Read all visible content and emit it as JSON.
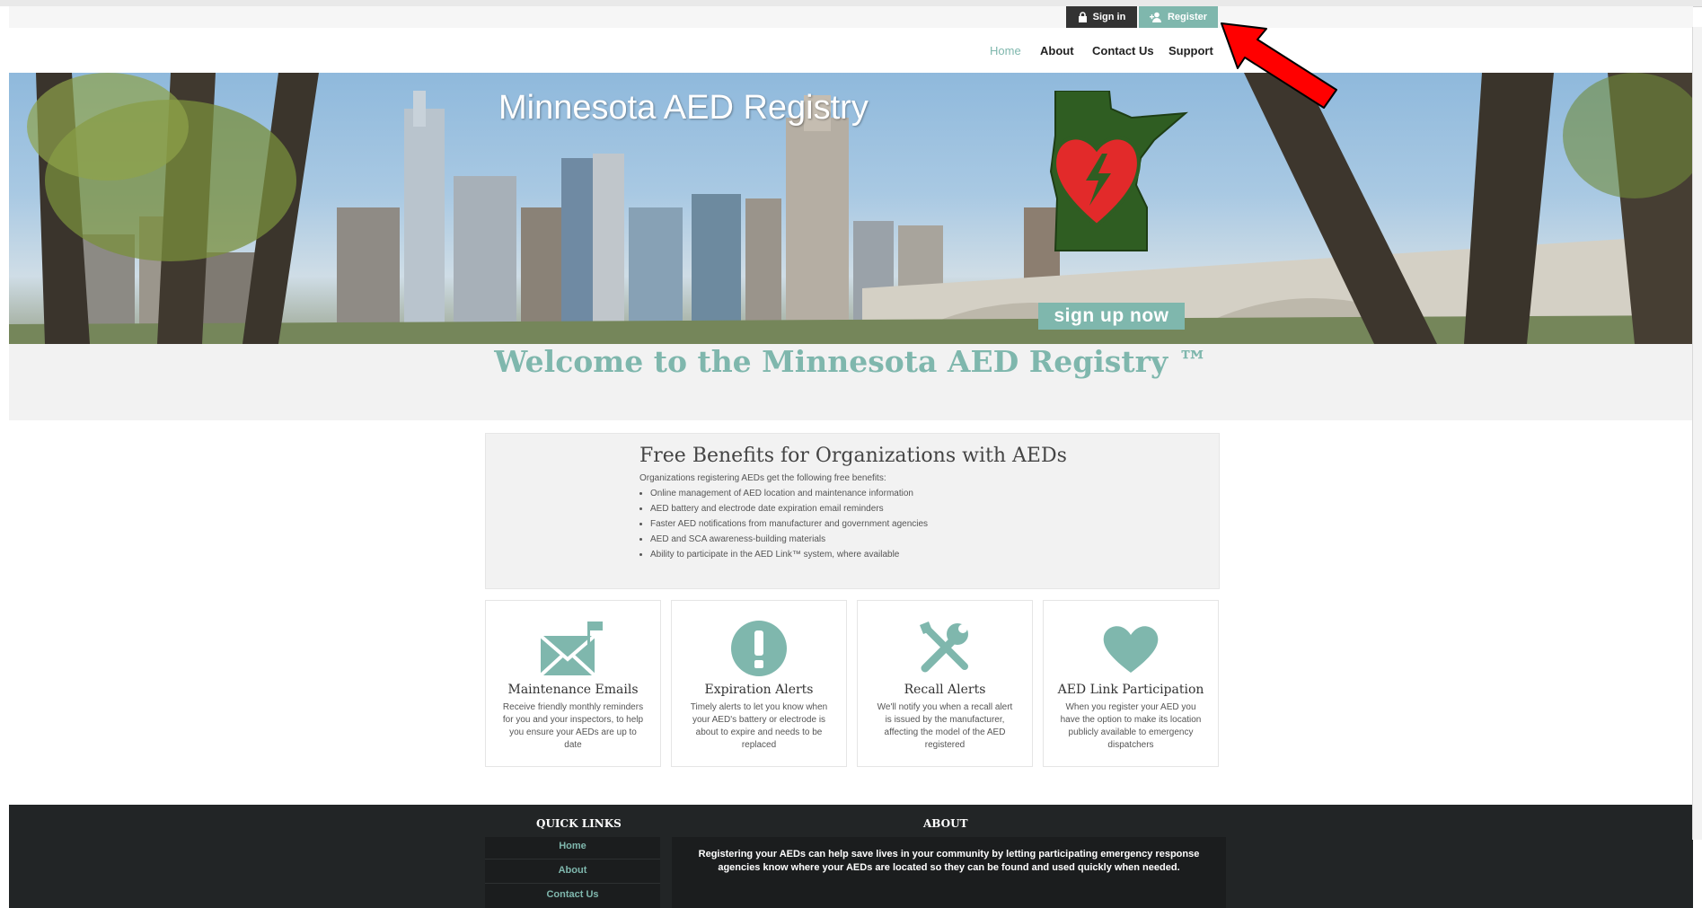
{
  "topbar": {
    "signin_label": "Sign in",
    "register_label": "Register"
  },
  "nav": {
    "home": "Home",
    "about": "About",
    "contact": "Contact Us",
    "support": "Support"
  },
  "hero": {
    "title": "Minnesota AED Registry",
    "signup_label": "sign up now"
  },
  "welcome": "Welcome to the Minnesota AED Registry ™",
  "benefits": {
    "title": "Free Benefits for Organizations with AEDs",
    "subtitle": "Organizations registering AEDs get the following free benefits:",
    "items": [
      "Online management of AED location and maintenance information",
      "AED battery and electrode date expiration email reminders",
      "Faster AED notifications from manufacturer and government agencies",
      "AED and SCA awareness-building materials",
      "Ability to participate in the AED Link™ system, where available"
    ]
  },
  "cards": [
    {
      "title": "Maintenance Emails",
      "desc": "Receive friendly monthly reminders for you and your inspectors, to help you ensure your AEDs are up to date",
      "icon": "envelope-icon"
    },
    {
      "title": "Expiration Alerts",
      "desc": "Timely alerts to let you know when your AED's battery or electrode is about to expire and needs to be replaced",
      "icon": "exclamation-icon"
    },
    {
      "title": "Recall Alerts",
      "desc": "We'll notify you when a recall alert is issued by the manufacturer, affecting the model of the AED registered",
      "icon": "tools-icon"
    },
    {
      "title": "AED Link Participation",
      "desc": "When you register your AED you have the option to make its location publicly available to emergency dispatchers",
      "icon": "heart-icon"
    }
  ],
  "footer": {
    "quick_links_title": "QUICK LINKS",
    "about_title": "ABOUT",
    "links": [
      "Home",
      "About",
      "Contact Us"
    ],
    "about_text": "Registering your AEDs can help save lives in your community by letting participating emergency response agencies know where your AEDs are located so they can be found and used quickly when needed."
  },
  "colors": {
    "accent": "#7fb7ad",
    "dark": "#333333",
    "footer": "#222526",
    "arrow": "#ff0000"
  }
}
